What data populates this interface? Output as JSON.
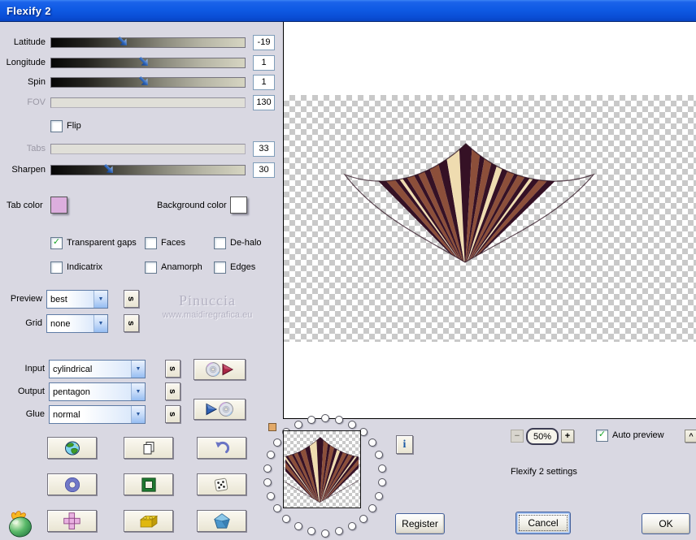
{
  "window": {
    "title": "Flexify 2"
  },
  "sliders": [
    {
      "label": "Latitude",
      "value": "-19",
      "pct": 37,
      "disabled": false
    },
    {
      "label": "Longitude",
      "value": "1",
      "pct": 48,
      "disabled": false
    },
    {
      "label": "Spin",
      "value": "1",
      "pct": 48,
      "disabled": false
    },
    {
      "label": "FOV",
      "value": "130",
      "pct": null,
      "disabled": true
    },
    {
      "label": "Tabs",
      "value": "33",
      "pct": null,
      "disabled": true
    },
    {
      "label": "Sharpen",
      "value": "30",
      "pct": 30,
      "disabled": false
    }
  ],
  "flip": {
    "label": "Flip",
    "checked": false
  },
  "swatches": {
    "tab_color_label": "Tab color",
    "tab_color": "#dcaede",
    "background_color_label": "Background color",
    "background_color": "#ffffff"
  },
  "checkboxes": [
    {
      "label": "Transparent gaps",
      "checked": true
    },
    {
      "label": "Faces",
      "checked": false
    },
    {
      "label": "De-halo",
      "checked": false
    },
    {
      "label": "Indicatrix",
      "checked": false
    },
    {
      "label": "Anamorph",
      "checked": false
    },
    {
      "label": "Edges",
      "checked": false
    }
  ],
  "dropdowns": [
    {
      "label": "Preview",
      "value": "best"
    },
    {
      "label": "Grid",
      "value": "none"
    },
    {
      "label": "Input",
      "value": "cylindrical"
    },
    {
      "label": "Output",
      "value": "pentagon"
    },
    {
      "label": "Glue",
      "value": "normal"
    }
  ],
  "s_button_label": "s",
  "watermark": {
    "line1": "Pinuccia",
    "line2": "www.maidiregrafica.eu"
  },
  "zoom": {
    "minus": "−",
    "level": "50%",
    "plus": "+",
    "auto_preview_label": "Auto preview",
    "auto_preview_checked": true,
    "collapse": "^"
  },
  "status": {
    "settings_label": "Flexify 2 settings"
  },
  "buttons": {
    "register": "Register",
    "cancel": "Cancel",
    "ok": "OK",
    "info": "i"
  },
  "artwork": {
    "colors": {
      "d": "#351125",
      "b": "#8c4f3a",
      "c": "#efdcb0"
    },
    "stripes": [
      {
        "c": "d",
        "w": 2
      },
      {
        "c": "b",
        "w": 2.4
      },
      {
        "c": "d",
        "w": 1.2
      },
      {
        "c": "c",
        "w": 0.9
      },
      {
        "c": "d",
        "w": 1.2
      },
      {
        "c": "b",
        "w": 2
      },
      {
        "c": "d",
        "w": 1.1
      },
      {
        "c": "b",
        "w": 1.7
      },
      {
        "c": "d",
        "w": 1.4
      },
      {
        "c": "b",
        "w": 2.2
      },
      {
        "c": "d",
        "w": 1.9
      },
      {
        "c": "c",
        "w": 2.6
      },
      {
        "c": "d",
        "w": 2.3
      },
      {
        "c": "b",
        "w": 1.6
      },
      {
        "c": "d",
        "w": 1
      },
      {
        "c": "b",
        "w": 1.6
      },
      {
        "c": "d",
        "w": 1.3
      },
      {
        "c": "c",
        "w": 1.4
      },
      {
        "c": "d",
        "w": 1.4
      },
      {
        "c": "b",
        "w": 1.8
      },
      {
        "c": "d",
        "w": 1
      },
      {
        "c": "b",
        "w": 1.9
      },
      {
        "c": "d",
        "w": 1.4
      },
      {
        "c": "c",
        "w": 0.9
      },
      {
        "c": "d",
        "w": 1.7
      },
      {
        "c": "b",
        "w": 2.2
      },
      {
        "c": "d",
        "w": 2
      }
    ]
  }
}
